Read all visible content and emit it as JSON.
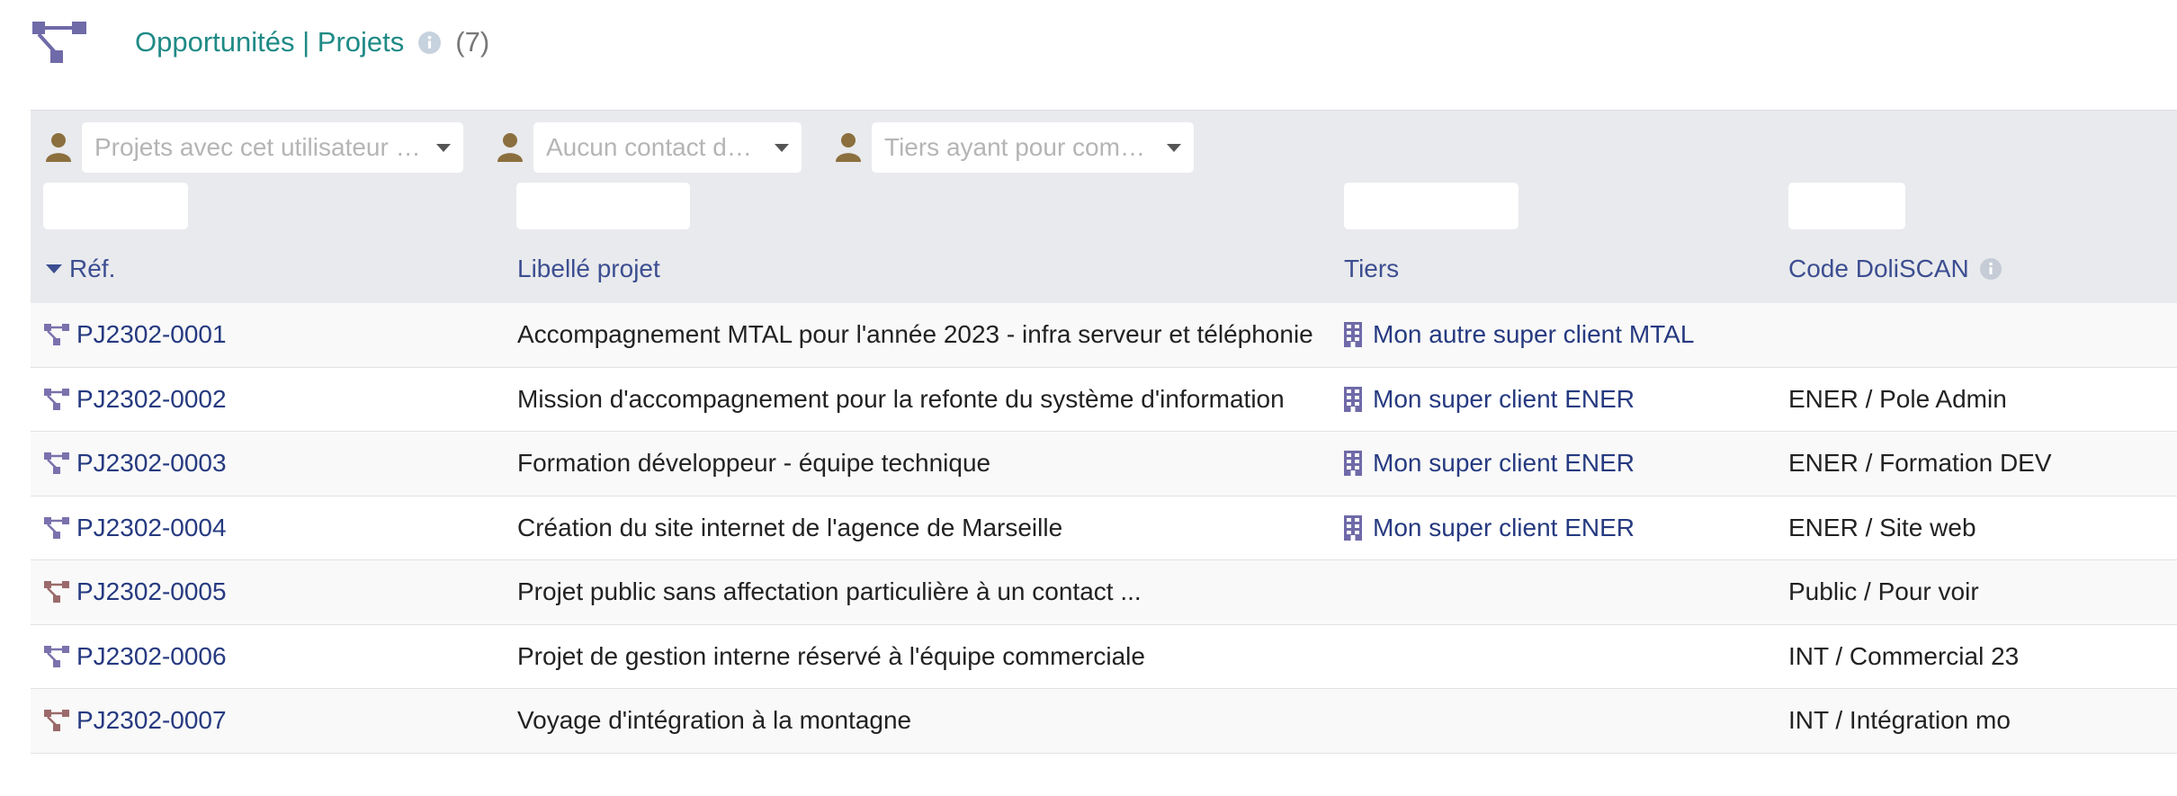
{
  "header": {
    "title": "Opportunités | Projets",
    "count": "(7)",
    "logo_icon": "project-tree-icon",
    "brand_color": "#1f8a86"
  },
  "filters": {
    "user_select": "Projets avec cet utilisateur comme contact",
    "contact_select": "Aucun contact de projet",
    "thirdparty_select": "Tiers ayant pour commercial"
  },
  "columns": {
    "ref": "Réf.",
    "label": "Libellé projet",
    "thirdparty": "Tiers",
    "code": "Code DoliSCAN"
  },
  "rows": [
    {
      "ref": "PJ2302-0001",
      "label": "Accompagnement MTAL pour l'année 2023 - infra serveur et téléphonie",
      "thirdparty": "Mon autre super client MTAL",
      "code": "",
      "icon_color": "#7a72ad"
    },
    {
      "ref": "PJ2302-0002",
      "label": "Mission d'accompagnement pour la refonte du système d'information",
      "thirdparty": "Mon super client ENER",
      "code": "ENER / Pole Admin",
      "icon_color": "#7a72ad"
    },
    {
      "ref": "PJ2302-0003",
      "label": "Formation développeur - équipe technique",
      "thirdparty": "Mon super client ENER",
      "code": "ENER / Formation DEV",
      "icon_color": "#7a72ad"
    },
    {
      "ref": "PJ2302-0004",
      "label": "Création du site internet de l'agence de Marseille",
      "thirdparty": "Mon super client ENER",
      "code": "ENER / Site web",
      "icon_color": "#7a72ad"
    },
    {
      "ref": "PJ2302-0005",
      "label": "Projet public sans affectation particulière à un contact ...",
      "thirdparty": "",
      "code": "Public / Pour voir",
      "icon_color": "#9b6a6a"
    },
    {
      "ref": "PJ2302-0006",
      "label": "Projet de gestion interne réservé à l'équipe commerciale",
      "thirdparty": "",
      "code": "INT / Commercial 23",
      "icon_color": "#7a72ad"
    },
    {
      "ref": "PJ2302-0007",
      "label": "Voyage d'intégration à la montagne",
      "thirdparty": "",
      "code": "INT / Intégration mo",
      "icon_color": "#9b6a6a"
    }
  ]
}
